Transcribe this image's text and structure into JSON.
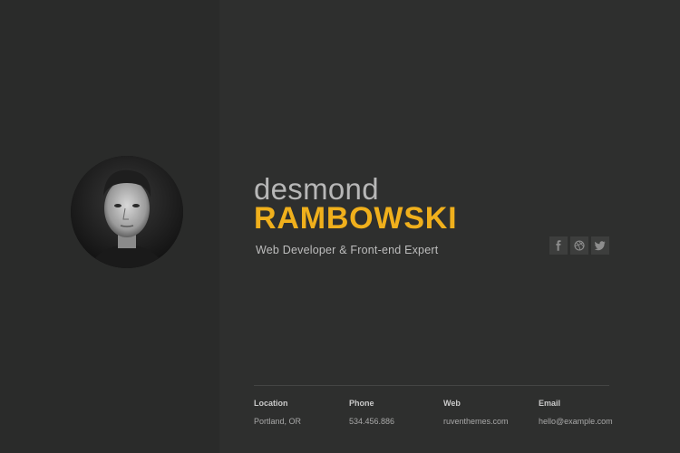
{
  "profile": {
    "first_name": "desmond",
    "last_name": "RAMBOWSKI",
    "tagline": "Web Developer & Front-end Expert"
  },
  "social": [
    {
      "icon": "facebook-icon"
    },
    {
      "icon": "dribbble-icon"
    },
    {
      "icon": "twitter-icon"
    }
  ],
  "contact": [
    {
      "label": "Location",
      "value": "Portland, OR"
    },
    {
      "label": "Phone",
      "value": "534.456.886"
    },
    {
      "label": "Web",
      "value": "ruventhemes.com"
    },
    {
      "label": "Email",
      "value": "hello@example.com"
    }
  ],
  "colors": {
    "accent": "#f0b01c",
    "background": "#2e2f2e",
    "sidebar": "#2a2b2a"
  }
}
